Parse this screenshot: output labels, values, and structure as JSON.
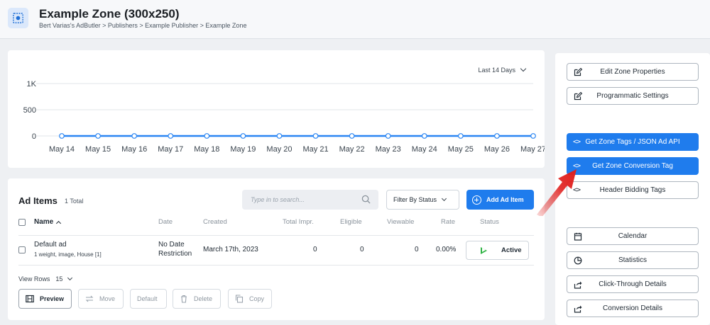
{
  "header": {
    "title": "Example Zone (300x250)",
    "breadcrumb": "Bert Varias's AdButler > Publishers > Example Publisher > Example Zone",
    "icon": "zone-icon"
  },
  "chart": {
    "range_label": "Last 14 Days"
  },
  "chart_data": {
    "type": "line",
    "x": [
      "May 14",
      "May 15",
      "May 16",
      "May 17",
      "May 18",
      "May 19",
      "May 20",
      "May 21",
      "May 22",
      "May 23",
      "May 24",
      "May 25",
      "May 26",
      "May 27"
    ],
    "series": [
      {
        "values": [
          0,
          0,
          0,
          0,
          0,
          0,
          0,
          0,
          0,
          0,
          0,
          0,
          0,
          0
        ]
      }
    ],
    "yticks": [
      "0",
      "500",
      "1K"
    ],
    "ylim": [
      0,
      1000
    ],
    "grid": true,
    "color": "#2b86f3"
  },
  "ad_items": {
    "title": "Ad Items",
    "count": "1 Total",
    "search_placeholder": "Type in to search...",
    "filter_label": "Filter By Status",
    "add_label": "Add Ad Item",
    "columns": {
      "name": "Name",
      "date": "Date",
      "created": "Created",
      "total": "Total Impr.",
      "eligible": "Eligible",
      "viewable": "Viewable",
      "rate": "Rate",
      "status": "Status"
    },
    "rows": [
      {
        "name": "Default ad",
        "meta": "1 weight, image, House [1]",
        "date_line1": "No Date",
        "date_line2": "Restriction",
        "created": "March 17th, 2023",
        "total": "0",
        "eligible": "0",
        "viewable": "0",
        "rate": "0.00%",
        "status": "Active"
      }
    ],
    "view_rows_label": "View Rows",
    "view_rows_value": "15",
    "toolbar": {
      "preview": "Preview",
      "move": "Move",
      "default": "Default",
      "delete": "Delete",
      "copy": "Copy"
    }
  },
  "sidebar": {
    "buttons": [
      {
        "label": "Edit Zone Properties",
        "icon": "edit-icon"
      },
      {
        "label": "Programmatic Settings",
        "icon": "edit-icon"
      },
      {
        "label": "Get Zone Tags / JSON Ad API",
        "icon": "code-icon",
        "code": "<>"
      },
      {
        "label": "Get Zone Conversion Tag",
        "icon": "code-icon",
        "code": "<>"
      },
      {
        "label": "Header Bidding Tags",
        "icon": "code-icon",
        "code": "<>"
      },
      {
        "label": "Calendar",
        "icon": "calendar-icon"
      },
      {
        "label": "Statistics",
        "icon": "chart-icon"
      },
      {
        "label": "Click-Through Details",
        "icon": "share-icon"
      },
      {
        "label": "Conversion Details",
        "icon": "share-icon"
      }
    ]
  },
  "colors": {
    "accent": "#1f7ced",
    "active_status": "#2fb344",
    "annotation_arrow": "#e0201e"
  }
}
